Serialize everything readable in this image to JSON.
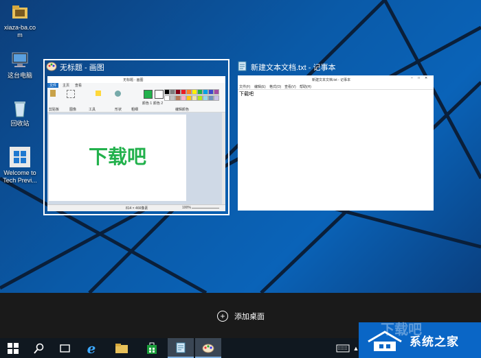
{
  "desktop": {
    "icons": [
      {
        "label": "xiaza-ba.co m",
        "icon": "folder-icon"
      },
      {
        "label": "这台电脑",
        "icon": "computer-icon"
      },
      {
        "label": "回收站",
        "icon": "recycle-bin-icon"
      },
      {
        "label": "Welcome to Tech Previ...",
        "icon": "windows-logo-icon"
      }
    ]
  },
  "taskview": {
    "paint": {
      "title": "无标题 - 画图",
      "inner_title": "无标题 - 画图",
      "tabs": [
        "文件",
        "主页",
        "查看"
      ],
      "groups": [
        "剪贴板",
        "图像",
        "工具",
        "形状",
        "粗细",
        "颜色 1",
        "颜色 2",
        "编辑颜色"
      ],
      "canvas_text": "下载吧",
      "status_size": "814 × 466像素",
      "zoom": "100%"
    },
    "notepad": {
      "title": "新建文本文档.txt - 记事本",
      "inner_title": "新建文本文档.txt - 记事本",
      "menu": [
        "文件(F)",
        "编辑(E)",
        "格式(O)",
        "查看(V)",
        "帮助(H)"
      ],
      "content": "下载吧"
    },
    "add_desktop": "添加桌面"
  },
  "taskbar": {
    "items": [
      "start-button",
      "search-icon",
      "task-view-icon",
      "ie-icon",
      "file-explorer-icon",
      "store-icon",
      "notepad-icon",
      "paint-icon"
    ]
  },
  "watermark": {
    "text": "系统之家",
    "top_text": "下载吧"
  },
  "colors": {
    "accent_green": "#22b14c",
    "taskbar": "#101820",
    "selection_border": "#ffffff"
  }
}
